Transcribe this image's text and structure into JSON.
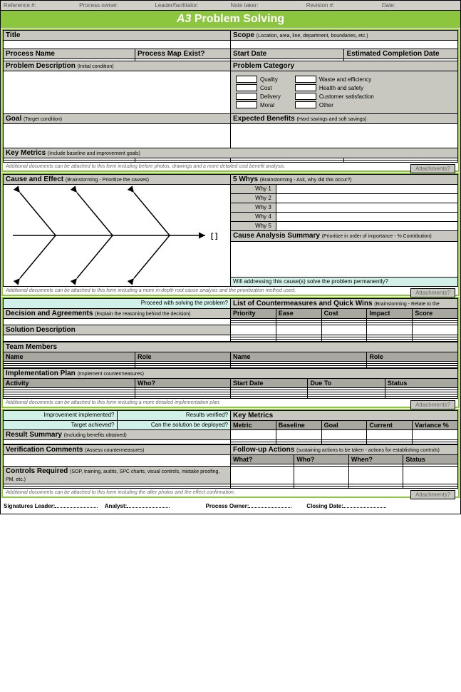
{
  "top": {
    "ref": "Reference #:",
    "owner": "Process owner:",
    "leader": "Leader/facilitator:",
    "notetaker": "Note taker:",
    "rev": "Revision #:",
    "date": "Date:"
  },
  "banner": {
    "prefix": "A3",
    "title": "Problem Solving"
  },
  "s1": {
    "title": "Title",
    "scope": "Scope",
    "scope_sub": "(Location, area, line, department, boundaries, etc.)",
    "pname": "Process Name",
    "pmap": "Process Map Exist?",
    "sdate": "Start Date",
    "edate": "Estimated Completion Date",
    "pdesc": "Problem Description",
    "pdesc_sub": "(Initial condition)",
    "pcat": "Problem Category",
    "cat1": [
      "Quality",
      "Cost",
      "Delivery",
      "Moral"
    ],
    "cat2": [
      "Waste and efficiency",
      "Health and safety",
      "Customer satisfaction",
      "Other"
    ],
    "goal": "Goal",
    "goal_sub": "(Target condition)",
    "benefits": "Expected Benefits",
    "benefits_sub": "(Hard savings and soft savings)",
    "metrics": "Key Metrics",
    "metrics_sub": "(Include baseline and improvement goals)",
    "note": "Additional documents can be attached to this form including before photos, drawings and a more detailed cost benefit analysis.",
    "att": "Attachments?"
  },
  "s2": {
    "cause": "Cause and Effect",
    "cause_sub": "(Brainstorming - Prioritize the causes)",
    "whys": "5 Whys",
    "whys_sub": "(Brainstorming - Ask, why did this occur?)",
    "why": [
      "Why 1",
      "Why 2",
      "Why 3",
      "Why 4",
      "Why 5"
    ],
    "summary": "Cause Analysis Summary",
    "summary_sub": "(Prioritize in order of importance - % Contribution)",
    "q": "Will addressing this cause(s) solve the problem permanently?",
    "note": "Additional documents can be attached to this form including a more in-depth root cause analysis and the prioritization method used.",
    "att": "Attachments?"
  },
  "s3": {
    "proceed": "Proceed with solving the problem?",
    "dec": "Decision and Agreements",
    "dec_sub": "(Explain the reasoning behind the decision)",
    "list": "List of Countermeasures and Quick Wins",
    "list_sub": "(Brainstorming - Relate to the",
    "cols": [
      "Priority",
      "Ease",
      "Cost",
      "Impact",
      "Score"
    ],
    "sol": "Solution Description",
    "team": "Team Members",
    "tname": "Name",
    "trole": "Role",
    "plan": "Implementation Plan",
    "plan_sub": "(Implement countermeasures)",
    "pcols": [
      "Activity",
      "Who?",
      "Start Date",
      "Due To",
      "Status"
    ],
    "note": "Additional documents can be attached to this form including a more detailed implementation plan.",
    "att": "Attachments?"
  },
  "s4": {
    "q1": "Improvement implemented?",
    "q2": "Results verified?",
    "q3": "Target achieved?",
    "q4": "Can the solution be deployed?",
    "km": "Key Metrics",
    "kcols": [
      "Metric",
      "Baseline",
      "Goal",
      "Current",
      "Variance %"
    ],
    "rs": "Result Summary",
    "rs_sub": "(Including benefits obtained)",
    "vc": "Verification Comments",
    "vc_sub": "(Assess countermeasures)",
    "fa": "Follow-up Actions",
    "fa_sub": "(sustaining actions to be taken - actions for establishing controls)",
    "fcols": [
      "What?",
      "Who?",
      "When?",
      "Status"
    ],
    "cr": "Controls Required",
    "cr_sub": "(SOP, training, audits, SPC charts, visual controls, mistake proofing, PM, etc.)",
    "note": "Additional documents can be attached to this form including the after photos and the effect confirmation.",
    "att": "Attachments?"
  },
  "sig": {
    "leader": "Signatures Leader:",
    "analyst": "Analyst:",
    "owner": "Process Owner:",
    "closing": "Closing Date:"
  }
}
